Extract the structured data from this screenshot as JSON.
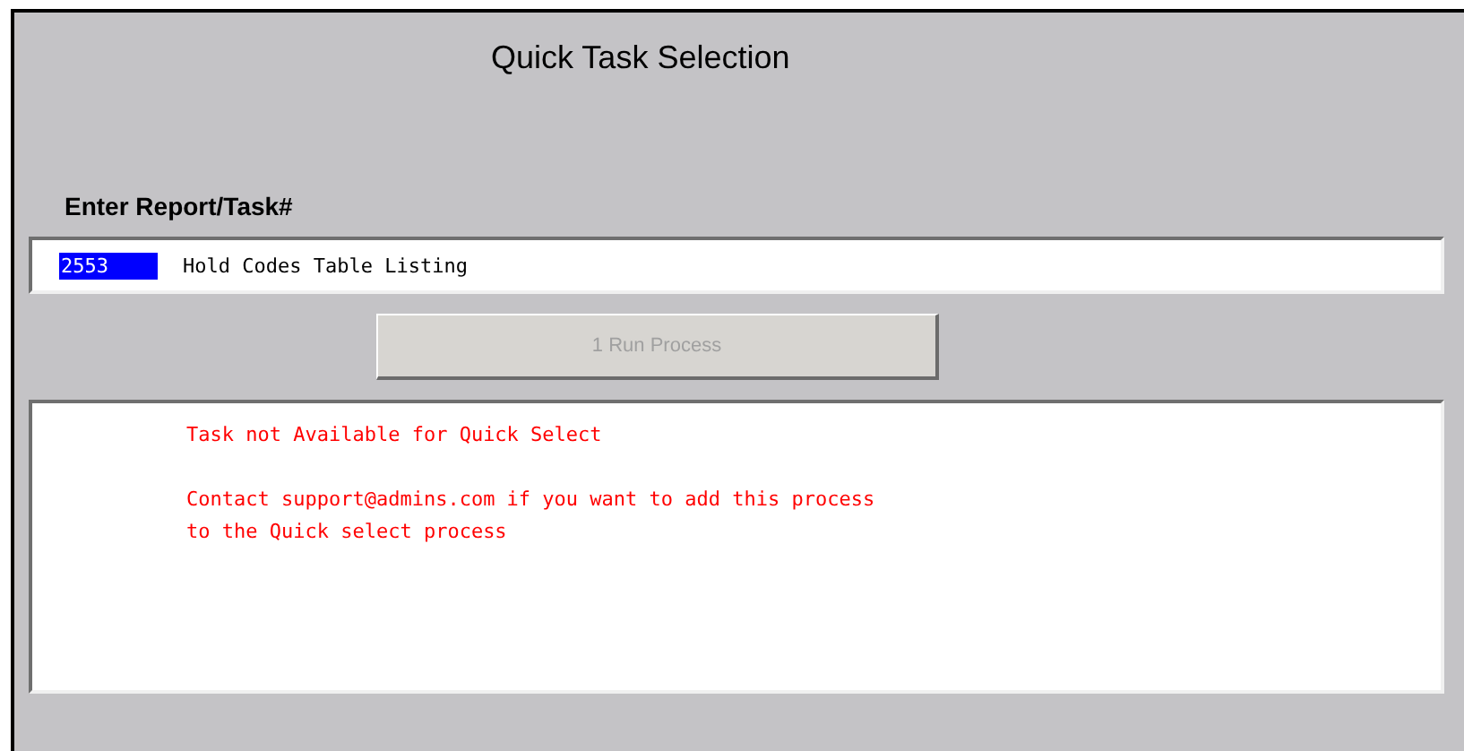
{
  "window": {
    "title": "Quick Task Selection"
  },
  "task_entry": {
    "label": "Enter Report/Task#",
    "value": "2553",
    "selected": true,
    "description": "Hold Codes Table Listing"
  },
  "run_button": {
    "label": "1 Run Process",
    "disabled": true
  },
  "message_paragraphs": [
    [
      "Task not Available for Quick Select"
    ],
    [
      "Contact support@admins.com if you want to add this process",
      "to the Quick select process"
    ]
  ]
}
